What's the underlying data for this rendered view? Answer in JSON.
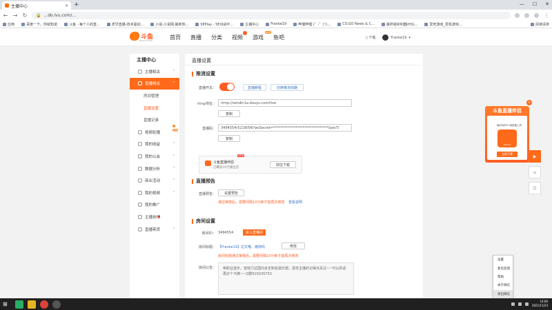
{
  "browser": {
    "tab_title": "主播中心",
    "tab_close": "×",
    "newtab": "+",
    "url": "...do.ivu.com/...",
    "controls": [
      "—",
      "☐",
      "✕"
    ],
    "bookmarks": [
      "应用",
      "百度一下，你就知道",
      "斗鱼 - 每个人的直...",
      "虎牙直播-技术驱动...",
      "小说,小说网,最新热...",
      "SEPlay - 5E对战平...",
      "主播中心",
      "Franke19",
      "哔哩哔哩 (゜-゜)つ...",
      "CS:GO News & C...",
      "最终组织利器(HS)...",
      "爱死游戏_爱机游戏..."
    ],
    "reading_list": "阅读清单"
  },
  "header": {
    "logo_text": "斗鱼",
    "logo_sub": "DOUYU.COM",
    "nav": [
      "首页",
      "直播",
      "分类",
      "视频",
      "游戏",
      "鱼吧"
    ],
    "nav_new_badge": "NEW",
    "download": "下载",
    "username": "Franke19",
    "user_chevron": "▾"
  },
  "sidebar": {
    "title": "主播中心",
    "items": [
      {
        "label": "主播相关",
        "chev": "^"
      },
      {
        "label": "直播相关",
        "chev": "^"
      },
      {
        "label": "房间管理"
      },
      {
        "label": "直播设置"
      },
      {
        "label": "直播记录"
      },
      {
        "label": "视频轮播",
        "tag": "活动"
      },
      {
        "label": "我的收益",
        "chev": "^"
      },
      {
        "label": "我的公会",
        "chev": "^"
      },
      {
        "label": "数据分析",
        "chev": "^"
      },
      {
        "label": "商业活动",
        "chev": "^"
      },
      {
        "label": "我的视频",
        "chev": "^"
      },
      {
        "label": "我的推广"
      },
      {
        "label": "主播扶持"
      },
      {
        "label": "直播带货",
        "chev": "^"
      }
    ]
  },
  "main": {
    "page_title": "直播设置",
    "push": {
      "heading": "推流设置",
      "switch_label": "直播开关：",
      "link_tutorial": "直播教程",
      "link_switch_room": "切换推流线路",
      "rtmp_label": "rtmp地址：",
      "rtmp_value": "rtmp://sendtc1a.douyu.com/live",
      "copy_btn": "复制",
      "code_label": "直播码：",
      "code_value": "3494554r5218IIV6?wsSecret=********************************&wsTi",
      "copy_btn2": "复制"
    },
    "promo": {
      "title": "斗鱼直播伴侣",
      "sub": "已覆盖10万播出店",
      "new": "NEW",
      "btn": "前往下载"
    },
    "preview": {
      "heading": "直播预告",
      "label": "直播预告：",
      "btn": "设置预告",
      "note": "通过审核后，需要间隔10分钟才能再次修改",
      "link": "查看说明"
    },
    "room": {
      "heading": "房间设置",
      "id_label": "房间ID：",
      "id_value": "3494554",
      "enter_btn": "进入直播间",
      "title_label": "房间标题：",
      "title_value": "【Franke19】达文哦、烤肉吗",
      "edit_btn": "修改",
      "title_note": "房间标题通过审核后，需要间隔10分钟才能再次修改",
      "notice_label": "房间公告：",
      "notice_text": "希职业选手，曾效力过国内多支知名俱乐部，喜欢主播的记得点关注~~可以的话再办个卡牌~~Q群915035753"
    }
  },
  "float_ad": {
    "title": "斗鱼直播伴侣",
    "desc": "最好用的PC端直播工具",
    "app": "DOUYU",
    "btn": "立即下载",
    "close": "×"
  },
  "side_buttons": [
    "▶",
    "⌂",
    "☷"
  ],
  "context_menu": [
    "设置",
    "意见反馈",
    "帮助",
    "关于微信",
    "退出微信"
  ],
  "taskbar": {
    "start": "⊞",
    "time": "14:06",
    "date": "2021/11/23"
  },
  "colors": {
    "brand": "#ff6a1a",
    "link": "#3c74c8",
    "warn": "#ff5d23"
  }
}
